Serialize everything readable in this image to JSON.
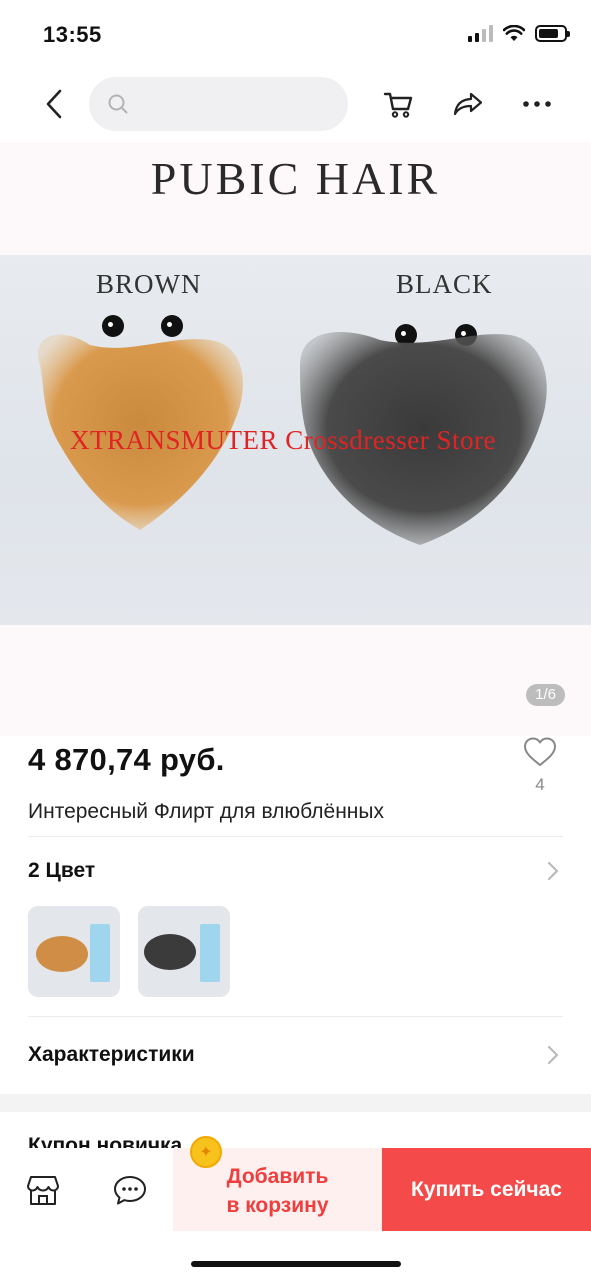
{
  "status": {
    "time": "13:55"
  },
  "nav": {
    "search_placeholder": ""
  },
  "gallery": {
    "title": "PUBIC HAIR",
    "label_left": "BROWN",
    "label_right": "BLACK",
    "watermark": "XTRANSMUTER Crossdresser Store",
    "page_indicator": "1/6"
  },
  "product": {
    "price": "4 870,74 руб.",
    "wishlist_count": "4",
    "title": "Интересный Флирт для влюблённых"
  },
  "color_section": {
    "title": "2 Цвет"
  },
  "specs_section": {
    "title": "Характеристики"
  },
  "coupon": {
    "title": "Купон новичка"
  },
  "bottom_bar": {
    "add_to_cart_line1": "Добавить",
    "add_to_cart_line2": "в корзину",
    "buy_now": "Купить сейчас"
  },
  "colors": {
    "accent": "#f44a4a",
    "accent_light": "#fff0f0"
  },
  "icons": [
    "chevron-left-icon",
    "search-icon",
    "cart-icon",
    "share-icon",
    "more-icon",
    "heart-icon",
    "chevron-right-icon",
    "store-icon",
    "chat-icon",
    "coin-icon"
  ]
}
